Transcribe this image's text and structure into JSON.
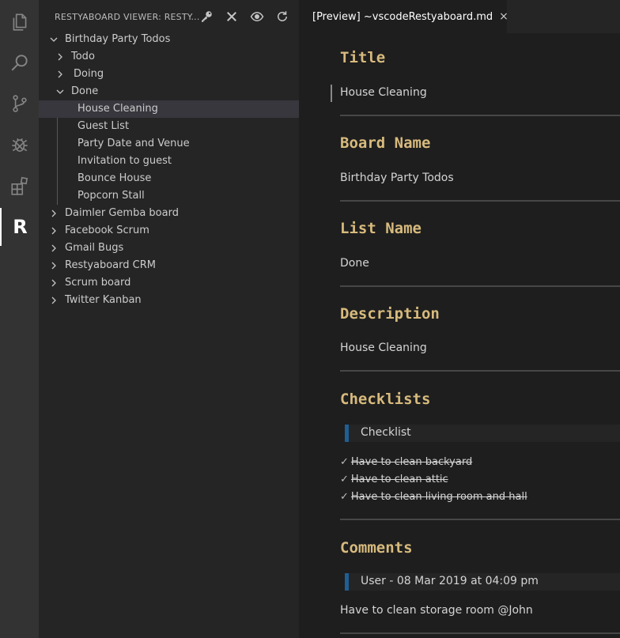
{
  "activity_bar": {
    "items": [
      {
        "icon": "files-icon"
      },
      {
        "icon": "search-icon"
      },
      {
        "icon": "source-control-icon"
      },
      {
        "icon": "debug-icon"
      },
      {
        "icon": "extensions-icon"
      },
      {
        "icon": "restyaboard-icon",
        "letter": "R"
      }
    ]
  },
  "sidebar": {
    "title": "RESTYABOARD VIEWER: RESTY...",
    "actions": [
      "key-icon",
      "close-icon",
      "eye-icon",
      "refresh-icon"
    ],
    "tree": [
      {
        "label": "Birthday Party Todos",
        "expanded": true
      },
      {
        "label": "Todo"
      },
      {
        "label": "Doing"
      },
      {
        "label": "Done",
        "expanded": true
      },
      {
        "label": "House Cleaning",
        "selected": true
      },
      {
        "label": "Guest List"
      },
      {
        "label": "Party Date and Venue"
      },
      {
        "label": "Invitation to guest"
      },
      {
        "label": "Bounce House"
      },
      {
        "label": "Popcorn Stall"
      },
      {
        "label": "Daimler Gemba board"
      },
      {
        "label": "Facebook Scrum"
      },
      {
        "label": "Gmail Bugs"
      },
      {
        "label": "Restyaboard CRM"
      },
      {
        "label": "Scrum board"
      },
      {
        "label": "Twitter Kanban"
      }
    ]
  },
  "editor": {
    "tab_label": "[Preview] ~vscodeRestyaboard.md",
    "tab_close": "×",
    "sections": {
      "title_heading": "Title",
      "title_value": "House Cleaning",
      "board_heading": "Board Name",
      "board_value": "Birthday Party Todos",
      "list_heading": "List Name",
      "list_value": "Done",
      "description_heading": "Description",
      "description_value": "House Cleaning",
      "checklists_heading": "Checklists",
      "checklist_name": "Checklist",
      "checklist_items": [
        "Have to clean backyard",
        "Have to clean attic",
        "Have to clean living room and hall"
      ],
      "check_mark": "✓",
      "comments_heading": "Comments",
      "comment_author": "User - 08 Mar 2019 at 04:09 pm",
      "comment_text": "Have to clean storage room @John"
    }
  }
}
